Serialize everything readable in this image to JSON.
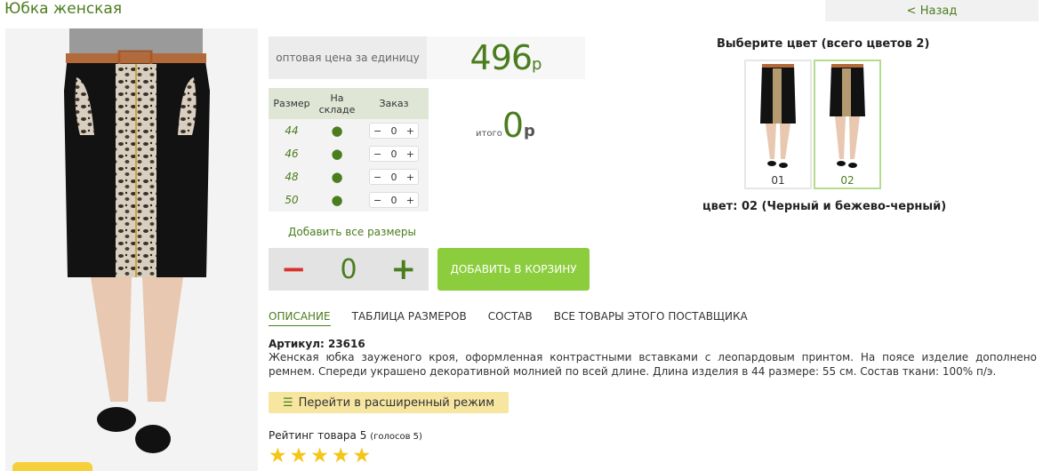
{
  "header": {
    "title": "Юбка женская",
    "back": "< Назад"
  },
  "price": {
    "label": "оптовая цена за единицу",
    "value": "496",
    "currency": "р"
  },
  "sizes": {
    "headers": [
      "Размер",
      "На складе",
      "Заказ"
    ],
    "rows": [
      {
        "size": "44",
        "stock": "●",
        "qty": "0"
      },
      {
        "size": "46",
        "stock": "●",
        "qty": "0"
      },
      {
        "size": "48",
        "stock": "●",
        "qty": "0"
      },
      {
        "size": "50",
        "stock": "●",
        "qty": "0"
      }
    ],
    "minus": "−",
    "plus": "+"
  },
  "total": {
    "label": "итого",
    "value": "0",
    "currency": "р"
  },
  "add_all": "Добавить все размеры",
  "stepper": {
    "minus": "−",
    "value": "0",
    "plus": "+"
  },
  "add_to_cart": "ДОБАВИТЬ В КОРЗИНУ",
  "tabs": [
    "ОПИСАНИЕ",
    "ТАБЛИЦА РАЗМЕРОВ",
    "СОСТАВ",
    "ВСЕ ТОВАРЫ ЭТОГО ПОСТАВЩИКА"
  ],
  "article": "Артикул: 23616",
  "description": "Женская юбка зауженого кроя, оформленная контрастными вставками с леопардовым принтом. На поясе изделие дополнено ремнем. Спереди украшено декоративной молнией по всей длине. Длина изделия в 44 размере: 55 см. Состав ткани: 100% п/э.",
  "extended_mode": "Перейти в расширенный режим",
  "rating": {
    "label": "Рейтинг товара 5",
    "votes": "(голосов 5)",
    "stars": 5
  },
  "colors": {
    "title": "Выберите цвет (всего цветов 2)",
    "items": [
      {
        "label": "01"
      },
      {
        "label": "02"
      }
    ],
    "selected_caption": "цвет: 02 (Черный и бежево-черный)"
  },
  "accent_color": "#4a7d1e",
  "button_color": "#8ccd3e"
}
